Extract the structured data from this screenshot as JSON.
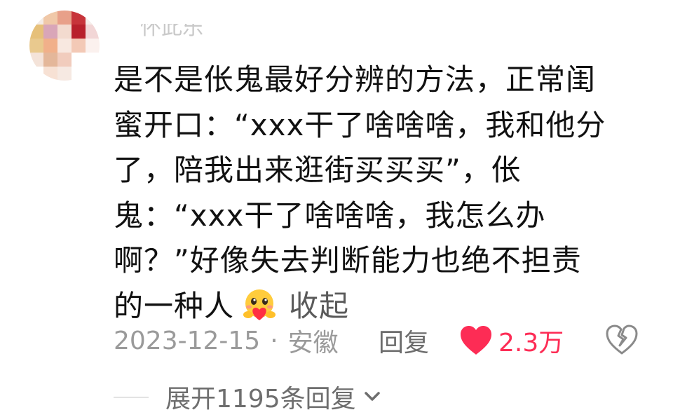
{
  "comment": {
    "username": "怀此乐",
    "text_lines": [
      "是不是伥鬼最好分辨的方法，正常闺",
      "蜜开口：“xxx干了啥啥啥，我和他分",
      "了，陪我出来逛街买买买”，伥",
      "鬼：“xxx干了啥啥啥，我怎么办",
      "啊？”好像失去判断能力也绝不担责",
      "的一种人"
    ],
    "emoji_icon": "hug-heart-emoji-icon",
    "collapse_label": "收起",
    "date": "2023-12-15",
    "separator": "·",
    "location": "安徽",
    "reply_label": "回复",
    "like_count": "2.3万",
    "like_color": "#fd2c55",
    "expand_label": "展开1195条回复"
  }
}
